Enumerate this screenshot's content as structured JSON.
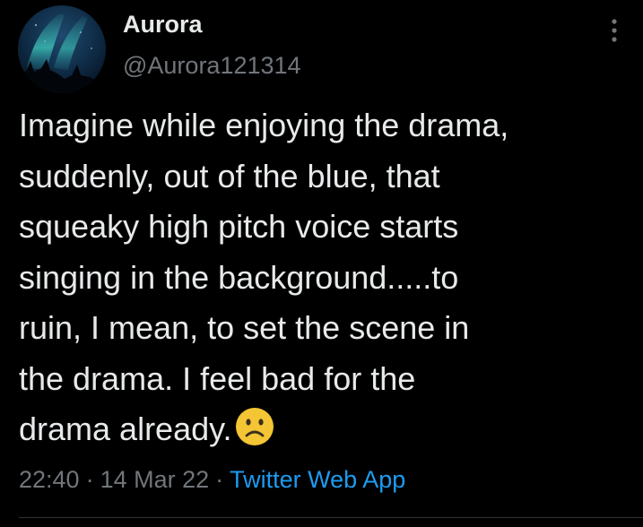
{
  "tweet": {
    "display_name": "Aurora",
    "handle": "@Aurora121314",
    "text": "Imagine while enjoying the drama,\nsuddenly, out of the blue, that\nsqueaky high pitch voice starts\nsinging in the background.....to\nruin, I mean, to set the scene in\nthe drama. I feel bad for the\ndrama already.",
    "emoji": "slightly-frowning-face",
    "time": "22:40",
    "date": "14 Mar 22",
    "separator": "·",
    "source": "Twitter Web App"
  },
  "icons": {
    "more": "vertical-ellipsis-icon",
    "avatar": "aurora-borealis-avatar"
  },
  "colors": {
    "background": "#000000",
    "primary_text": "#e7e9ea",
    "secondary_text": "#71767b",
    "link": "#1d9bf0",
    "divider": "#2f3336",
    "emoji_face": "#f4c534"
  }
}
